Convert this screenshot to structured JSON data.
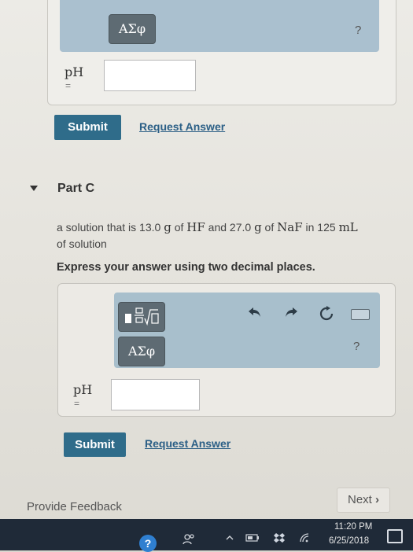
{
  "part_b": {
    "greek_label": "ΑΣφ",
    "help_label": "?",
    "ph_label": "pH",
    "equals": "=",
    "input_value": "",
    "submit_label": "Submit",
    "request_label": "Request Answer"
  },
  "part_c": {
    "title": "Part C",
    "problem_line1_a": "a solution that is 13.0 ",
    "problem_unit_g1": "g",
    "problem_of1": " of ",
    "problem_hf": "HF",
    "problem_and": " and 27.0 ",
    "problem_unit_g2": "g",
    "problem_of2": " of ",
    "problem_naf": "NaF",
    "problem_in": " in 125 ",
    "problem_ml": "mL",
    "problem_line2": "of solution",
    "instruction": "Express your answer using two decimal places.",
    "greek_label": "ΑΣφ",
    "help_label": "?",
    "ph_label": "pH",
    "equals": "=",
    "input_value": "",
    "submit_label": "Submit",
    "request_label": "Request Answer"
  },
  "toolbar_icons": [
    "templates-icon",
    "undo-icon",
    "redo-icon",
    "reset-icon",
    "keyboard-icon"
  ],
  "footer": {
    "feedback_label": "Provide Feedback",
    "next_label": "Next"
  },
  "taskbar": {
    "time": "11:20 PM",
    "date": "6/25/2018"
  },
  "colors": {
    "submit_bg": "#2f6c8a",
    "toolbar_bg": "#a8bfcc",
    "link": "#2b5f86"
  }
}
